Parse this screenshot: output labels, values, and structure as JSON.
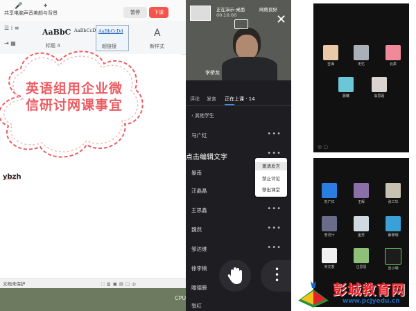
{
  "word": {
    "toolbar": {
      "btn1": "共享电脑声音",
      "btn2": "美颜与背景",
      "pause": "暂停",
      "stop": "下课"
    },
    "styles": [
      {
        "sample": "AaBbC",
        "caption": "标题 4"
      },
      {
        "sample": "AaBbCcDd",
        "caption": ""
      },
      {
        "sample": "AaBbCcDd",
        "caption": "超链接"
      }
    ],
    "new_style": "新样式",
    "new_style_icon_text": "A",
    "doc_fragments": [
      "Va",
      "ybzh"
    ],
    "status": "文档未保护",
    "cpu": "CPU"
  },
  "cloud_text": "英语组用企业微信研讨网课事宜",
  "meeting": {
    "presenting": "正在演示·桌面",
    "timer": "00:16:00",
    "network": "网络良好",
    "presenter": "李桥龙",
    "tabs": [
      "评论",
      "发言",
      "正在上课 · 14"
    ],
    "others_header": "其他学生",
    "students": [
      "马广红",
      "",
      "晏南",
      "汪晶晶",
      "王思鑫",
      "魏然",
      "邹达维",
      "徐李楠",
      "喻德膀",
      "张红"
    ],
    "edit_caption": "点击编辑文字",
    "popup": [
      "邀请发言",
      "禁止评论",
      "移出课堂"
    ]
  },
  "grid_top": {
    "avatars": [
      "吉海",
      "无忆",
      "云柔",
      "晨曦",
      "翁思嘉"
    ],
    "colors": [
      "#e9c9a8",
      "#a9b0b8",
      "#f08a9a",
      "#6bc7d8",
      "#d9d4d0"
    ]
  },
  "grid_bottom": {
    "avatars": [
      "刘广红",
      "王辉",
      "张三华",
      "李灵汁",
      "金芳",
      "蔡黎明",
      "辛文香",
      "汪思思",
      "曾小明"
    ],
    "colors": [
      "#2a7de1",
      "#8a6fa8",
      "#c7c2b0",
      "#6a6c8c",
      "#d0d8e0",
      "#3aa0d8",
      "#f2f2f2",
      "#8fc07a",
      "#1c1c1c"
    ]
  },
  "watermark": {
    "title": "彭城教育网",
    "url": "www.pcjyedu.cn"
  }
}
